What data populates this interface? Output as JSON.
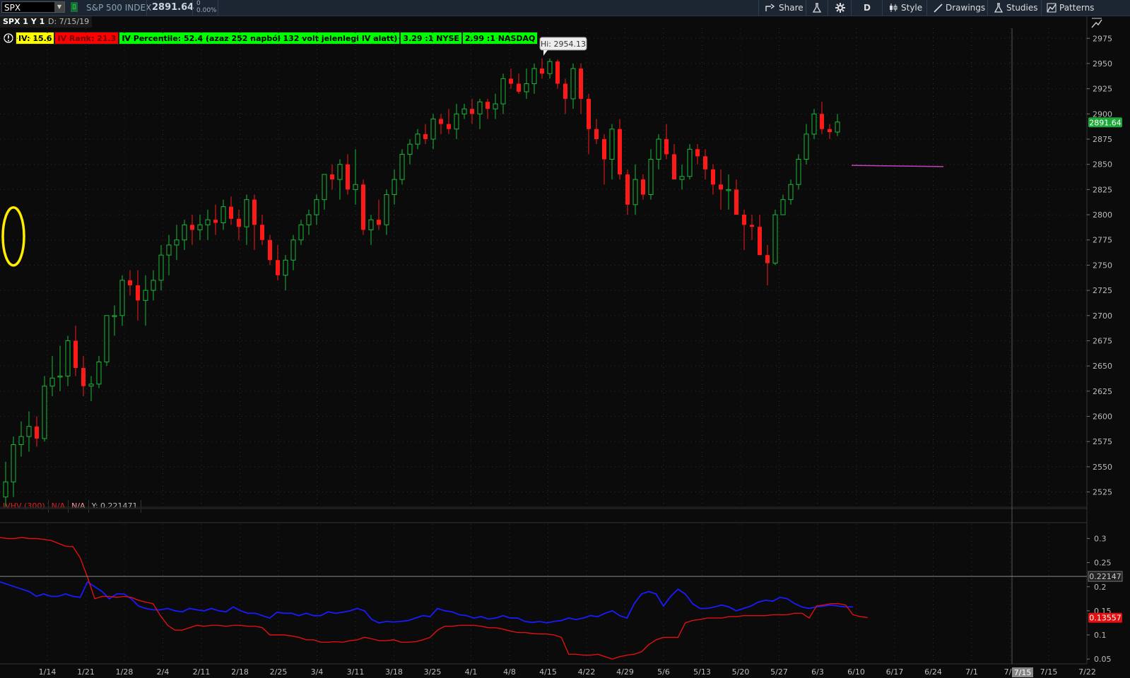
{
  "toolbar": {
    "symbol": "SPX",
    "index_name": "S&P 500 INDEX",
    "price": "2891.64",
    "change": "0",
    "change_pct": "0.00%",
    "share": "Share",
    "period_button": "D",
    "style": "Style",
    "drawings": "Drawings",
    "studies": "Studies",
    "patterns": "Patterns"
  },
  "chart_header": {
    "title": "SPX 1 Y 1D",
    "date": "D: 7/15/19"
  },
  "study_labels": {
    "iv": "IV: 15.6",
    "iv_rank": "IV Rank: 21.3",
    "iv_percentile": "IV Percentile: 52.4 (azaz 252 napból 132 volt jelenlegi IV alatt)",
    "nyse": "3.29 :1 NYSE",
    "nasdaq": "2.99 :1 NASDAQ"
  },
  "lower_header": {
    "study": "IVHV (300)",
    "v1": "N/A",
    "v2": "N/A",
    "y": "Y: 0.221471"
  },
  "colors": {
    "up": "#18b83a",
    "down": "#ff1a1a",
    "iv_line": "#1a1aff",
    "hv_line": "#e01010",
    "highlight": "#ffee00",
    "projection": "#c040c0"
  },
  "chart_data": [
    {
      "type": "candlestick",
      "ylim": [
        2510,
        2985
      ],
      "y_ticks": [
        2525,
        2550,
        2575,
        2600,
        2625,
        2650,
        2675,
        2700,
        2725,
        2750,
        2775,
        2800,
        2825,
        2850,
        2875,
        2900,
        2925,
        2950,
        2975
      ],
      "x_ticks": [
        "1/14",
        "1/21",
        "1/28",
        "2/4",
        "2/11",
        "2/18",
        "2/25",
        "3/4",
        "3/11",
        "3/18",
        "3/25",
        "4/1",
        "4/8",
        "4/15",
        "4/22",
        "4/29",
        "5/6",
        "5/13",
        "5/20",
        "5/27",
        "6/3",
        "6/10",
        "6/17",
        "6/24",
        "7/1",
        "7/8",
        "7/15",
        "7/22"
      ],
      "hi_label": "Hi: 2954.13",
      "last_price_label": "2891.64",
      "grid": true,
      "candles": [
        [
          2520,
          2555,
          2510,
          2535
        ],
        [
          2535,
          2580,
          2520,
          2572
        ],
        [
          2572,
          2595,
          2560,
          2580
        ],
        [
          2580,
          2605,
          2565,
          2590
        ],
        [
          2590,
          2600,
          2570,
          2578
        ],
        [
          2578,
          2640,
          2575,
          2630
        ],
        [
          2630,
          2660,
          2620,
          2638
        ],
        [
          2640,
          2670,
          2625,
          2640
        ],
        [
          2640,
          2680,
          2630,
          2675
        ],
        [
          2675,
          2690,
          2640,
          2648
        ],
        [
          2648,
          2660,
          2620,
          2630
        ],
        [
          2630,
          2640,
          2615,
          2632
        ],
        [
          2632,
          2660,
          2628,
          2654
        ],
        [
          2654,
          2700,
          2650,
          2700
        ],
        [
          2700,
          2710,
          2680,
          2700
        ],
        [
          2700,
          2740,
          2690,
          2735
        ],
        [
          2735,
          2745,
          2720,
          2730
        ],
        [
          2730,
          2745,
          2695,
          2715
        ],
        [
          2715,
          2740,
          2690,
          2725
        ],
        [
          2725,
          2745,
          2715,
          2735
        ],
        [
          2735,
          2770,
          2725,
          2760
        ],
        [
          2760,
          2780,
          2740,
          2770
        ],
        [
          2770,
          2790,
          2755,
          2775
        ],
        [
          2775,
          2795,
          2765,
          2790
        ],
        [
          2790,
          2800,
          2770,
          2785
        ],
        [
          2785,
          2800,
          2775,
          2790
        ],
        [
          2790,
          2805,
          2775,
          2795
        ],
        [
          2795,
          2810,
          2780,
          2792
        ],
        [
          2792,
          2815,
          2785,
          2808
        ],
        [
          2808,
          2818,
          2790,
          2796
        ],
        [
          2796,
          2805,
          2775,
          2788
        ],
        [
          2788,
          2820,
          2770,
          2815
        ],
        [
          2815,
          2820,
          2765,
          2790
        ],
        [
          2790,
          2800,
          2770,
          2775
        ],
        [
          2775,
          2780,
          2750,
          2755
        ],
        [
          2755,
          2770,
          2735,
          2740
        ],
        [
          2740,
          2760,
          2725,
          2755
        ],
        [
          2755,
          2780,
          2745,
          2775
        ],
        [
          2775,
          2795,
          2770,
          2790
        ],
        [
          2790,
          2805,
          2780,
          2800
        ],
        [
          2800,
          2820,
          2790,
          2815
        ],
        [
          2815,
          2840,
          2805,
          2840
        ],
        [
          2840,
          2850,
          2825,
          2835
        ],
        [
          2835,
          2855,
          2815,
          2850
        ],
        [
          2850,
          2860,
          2820,
          2825
        ],
        [
          2825,
          2865,
          2810,
          2830
        ],
        [
          2830,
          2835,
          2780,
          2785
        ],
        [
          2785,
          2800,
          2770,
          2795
        ],
        [
          2795,
          2815,
          2785,
          2790
        ],
        [
          2790,
          2825,
          2780,
          2820
        ],
        [
          2820,
          2845,
          2810,
          2835
        ],
        [
          2835,
          2865,
          2830,
          2860
        ],
        [
          2860,
          2875,
          2850,
          2870
        ],
        [
          2870,
          2885,
          2865,
          2880
        ],
        [
          2880,
          2890,
          2870,
          2875
        ],
        [
          2875,
          2900,
          2865,
          2895
        ],
        [
          2895,
          2900,
          2880,
          2890
        ],
        [
          2890,
          2905,
          2880,
          2885
        ],
        [
          2885,
          2910,
          2875,
          2900
        ],
        [
          2900,
          2910,
          2895,
          2905
        ],
        [
          2905,
          2915,
          2890,
          2900
        ],
        [
          2900,
          2915,
          2885,
          2912
        ],
        [
          2912,
          2915,
          2895,
          2905
        ],
        [
          2905,
          2920,
          2895,
          2910
        ],
        [
          2910,
          2940,
          2900,
          2935
        ],
        [
          2935,
          2945,
          2925,
          2930
        ],
        [
          2930,
          2940,
          2920,
          2922
        ],
        [
          2922,
          2945,
          2915,
          2930
        ],
        [
          2930,
          2950,
          2920,
          2945
        ],
        [
          2945,
          2955,
          2935,
          2940
        ],
        [
          2940,
          2955,
          2935,
          2952
        ],
        [
          2952,
          2954,
          2925,
          2930
        ],
        [
          2930,
          2935,
          2900,
          2915
        ],
        [
          2915,
          2950,
          2905,
          2945
        ],
        [
          2945,
          2950,
          2900,
          2915
        ],
        [
          2915,
          2920,
          2860,
          2885
        ],
        [
          2885,
          2895,
          2870,
          2875
        ],
        [
          2875,
          2880,
          2830,
          2855
        ],
        [
          2855,
          2890,
          2835,
          2885
        ],
        [
          2885,
          2895,
          2835,
          2840
        ],
        [
          2840,
          2845,
          2800,
          2810
        ],
        [
          2810,
          2850,
          2800,
          2835
        ],
        [
          2835,
          2840,
          2815,
          2820
        ],
        [
          2820,
          2865,
          2815,
          2855
        ],
        [
          2855,
          2880,
          2845,
          2875
        ],
        [
          2875,
          2890,
          2855,
          2860
        ],
        [
          2860,
          2870,
          2840,
          2835
        ],
        [
          2835,
          2850,
          2825,
          2838
        ],
        [
          2838,
          2870,
          2835,
          2865
        ],
        [
          2865,
          2870,
          2850,
          2858
        ],
        [
          2858,
          2865,
          2835,
          2845
        ],
        [
          2845,
          2850,
          2820,
          2830
        ],
        [
          2830,
          2845,
          2805,
          2825
        ],
        [
          2825,
          2840,
          2805,
          2825
        ],
        [
          2825,
          2835,
          2800,
          2800
        ],
        [
          2800,
          2805,
          2765,
          2790
        ],
        [
          2790,
          2800,
          2775,
          2788
        ],
        [
          2788,
          2800,
          2765,
          2760
        ],
        [
          2760,
          2770,
          2730,
          2752
        ],
        [
          2752,
          2805,
          2750,
          2800
        ],
        [
          2800,
          2820,
          2800,
          2815
        ],
        [
          2815,
          2835,
          2810,
          2830
        ],
        [
          2830,
          2860,
          2825,
          2855
        ],
        [
          2855,
          2890,
          2850,
          2880
        ],
        [
          2880,
          2905,
          2875,
          2900
        ],
        [
          2900,
          2912,
          2880,
          2885
        ],
        [
          2885,
          2890,
          2875,
          2882
        ],
        [
          2882,
          2900,
          2878,
          2892
        ]
      ]
    },
    {
      "type": "line",
      "ylim": [
        0.04,
        0.33
      ],
      "y_ticks": [
        0.05,
        0.1,
        0.15,
        0.2,
        0.25,
        0.3
      ],
      "cursor_label": "0.22147",
      "last_label": "0.13557",
      "series": [
        {
          "name": "IV",
          "values": [
            0.21,
            0.205,
            0.2,
            0.195,
            0.19,
            0.18,
            0.185,
            0.18,
            0.18,
            0.185,
            0.18,
            0.178,
            0.21,
            0.2,
            0.19,
            0.175,
            0.185,
            0.185,
            0.175,
            0.16,
            0.155,
            0.152,
            0.152,
            0.155,
            0.15,
            0.148,
            0.155,
            0.152,
            0.15,
            0.155,
            0.15,
            0.148,
            0.158,
            0.15,
            0.145,
            0.145,
            0.14,
            0.135,
            0.147,
            0.145,
            0.145,
            0.14,
            0.145,
            0.14,
            0.14,
            0.148,
            0.145,
            0.147,
            0.15,
            0.155,
            0.15,
            0.132,
            0.125,
            0.128,
            0.127,
            0.128,
            0.13,
            0.135,
            0.14,
            0.138,
            0.155,
            0.15,
            0.148,
            0.142,
            0.14,
            0.135,
            0.138,
            0.133,
            0.135,
            0.14,
            0.135,
            0.135,
            0.128,
            0.126,
            0.128,
            0.125,
            0.128,
            0.13,
            0.135,
            0.132,
            0.135,
            0.14,
            0.138,
            0.145,
            0.15,
            0.14,
            0.135,
            0.165,
            0.185,
            0.19,
            0.185,
            0.16,
            0.18,
            0.195,
            0.185,
            0.165,
            0.155,
            0.155,
            0.158,
            0.162,
            0.158,
            0.15,
            0.155,
            0.16,
            0.168,
            0.172,
            0.17,
            0.178,
            0.175,
            0.165,
            0.158,
            0.155,
            0.158,
            0.16,
            0.162,
            0.16,
            0.158,
            0.158
          ]
        },
        {
          "name": "HV",
          "values": [
            0.302,
            0.3,
            0.3,
            0.302,
            0.3,
            0.3,
            0.298,
            0.296,
            0.29,
            0.284,
            0.283,
            0.26,
            0.22,
            0.175,
            0.18,
            0.18,
            0.178,
            0.18,
            0.178,
            0.172,
            0.168,
            0.165,
            0.14,
            0.12,
            0.11,
            0.11,
            0.115,
            0.12,
            0.118,
            0.12,
            0.12,
            0.118,
            0.12,
            0.12,
            0.118,
            0.118,
            0.115,
            0.1,
            0.1,
            0.1,
            0.098,
            0.095,
            0.09,
            0.09,
            0.085,
            0.085,
            0.086,
            0.085,
            0.088,
            0.09,
            0.095,
            0.092,
            0.088,
            0.088,
            0.09,
            0.085,
            0.085,
            0.086,
            0.09,
            0.095,
            0.11,
            0.118,
            0.118,
            0.12,
            0.12,
            0.12,
            0.118,
            0.115,
            0.115,
            0.112,
            0.108,
            0.105,
            0.105,
            0.103,
            0.102,
            0.102,
            0.1,
            0.095,
            0.06,
            0.06,
            0.058,
            0.058,
            0.06,
            0.055,
            0.05,
            0.055,
            0.058,
            0.06,
            0.065,
            0.08,
            0.09,
            0.095,
            0.095,
            0.095,
            0.125,
            0.13,
            0.132,
            0.135,
            0.135,
            0.135,
            0.138,
            0.138,
            0.14,
            0.14,
            0.14,
            0.14,
            0.142,
            0.142,
            0.142,
            0.145,
            0.145,
            0.135,
            0.16,
            0.162,
            0.165,
            0.165,
            0.162,
            0.142,
            0.138,
            0.136
          ]
        }
      ]
    }
  ]
}
